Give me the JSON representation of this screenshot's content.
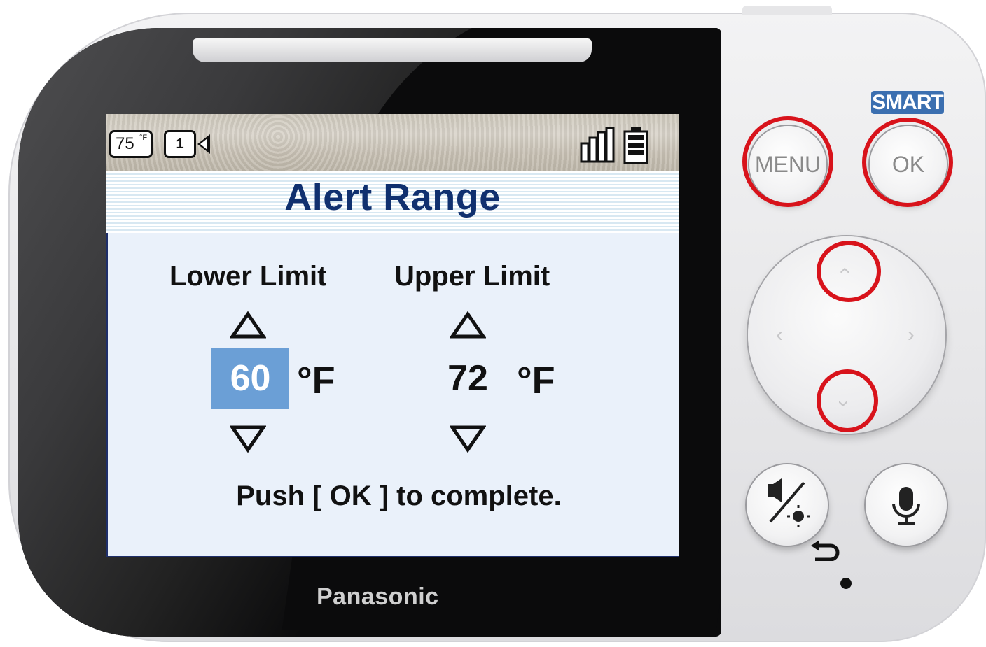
{
  "device": {
    "brand": "Panasonic"
  },
  "status_bar": {
    "temperature_value": "75",
    "temperature_unit": "°F",
    "camera_number": "1",
    "signal_icon": "signal-strength-icon",
    "battery_icon": "battery-icon"
  },
  "screen": {
    "title": "Alert Range",
    "lower": {
      "label": "Lower Limit",
      "value": "60",
      "unit": "°F",
      "selected": true
    },
    "upper": {
      "label": "Upper Limit",
      "value": "72",
      "unit": "°F",
      "selected": false
    },
    "hint": "Push [ OK ] to complete."
  },
  "controls": {
    "smart_label": "SMART",
    "menu_label": "MENU",
    "ok_label": "OK",
    "highlight_color": "#d8131b",
    "selection_color": "#6b9fd6",
    "title_color": "#10306f"
  }
}
